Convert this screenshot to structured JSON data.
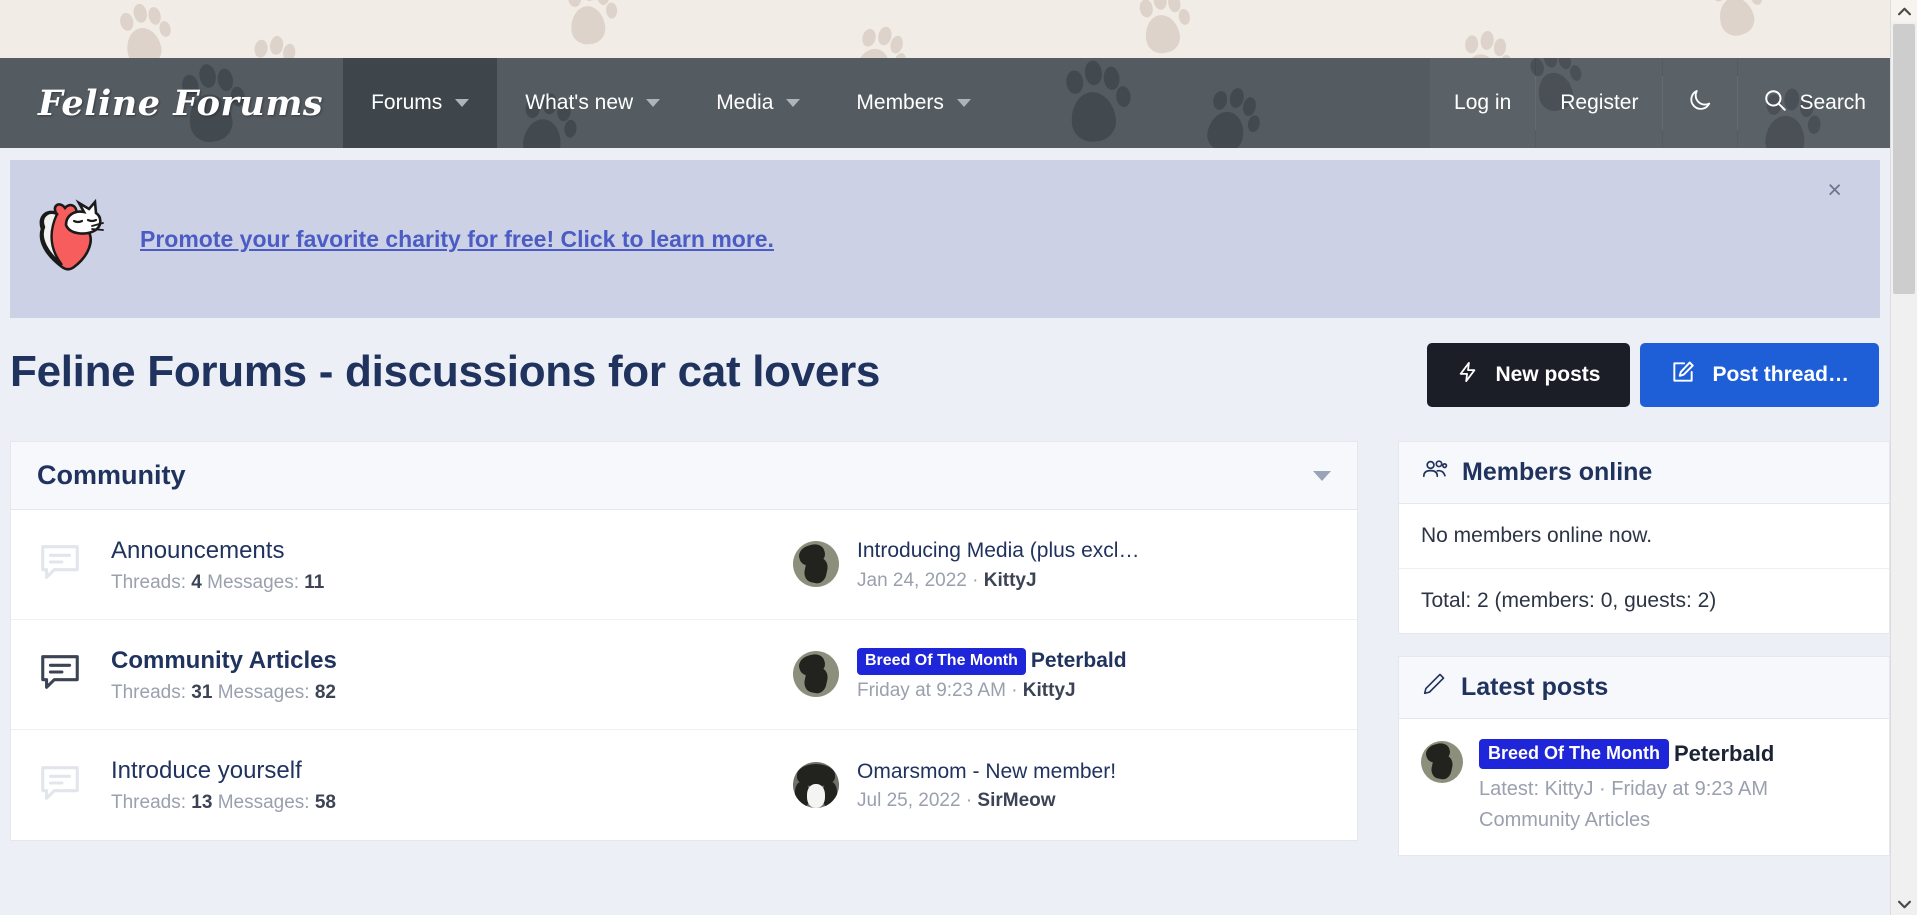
{
  "site": {
    "brand": "Feline Forums"
  },
  "nav": {
    "items": [
      {
        "label": "Forums",
        "has_caret": true,
        "active": true
      },
      {
        "label": "What's new",
        "has_caret": true,
        "active": false
      },
      {
        "label": "Media",
        "has_caret": true,
        "active": false
      },
      {
        "label": "Members",
        "has_caret": true,
        "active": false
      }
    ],
    "right": {
      "login": "Log in",
      "register": "Register",
      "dark_mode_icon": "moon-icon",
      "search": "Search",
      "search_icon": "search-icon"
    }
  },
  "notice": {
    "icon": "cat-heart-icon",
    "link_text": "Promote your favorite charity for free! Click to learn more.",
    "close_label": "×",
    "background": "#ccd1e6",
    "link_color": "#4b5cc4"
  },
  "header": {
    "title": "Feline Forums - discussions for cat lovers",
    "buttons": [
      {
        "label": "New posts",
        "icon": "lightning-icon",
        "style": "dark",
        "color": "#1b1e26"
      },
      {
        "label": "Post thread…",
        "icon": "pencil-square-icon",
        "style": "blue",
        "color": "#1e5fd8"
      }
    ]
  },
  "category": {
    "title": "Community",
    "collapse_icon": "chevron-down-icon",
    "forums": [
      {
        "name": "Announcements",
        "bold": false,
        "icon": "speech-bubble-icon",
        "stats_threads_label": "Threads:",
        "stats_threads_value": "4",
        "stats_messages_label": "Messages:",
        "stats_messages_value": "11",
        "last_post": {
          "avatar": "black-cat-avatar",
          "prefix": "",
          "title": "Introducing Media (plus excl…",
          "date": "Jan 24, 2022",
          "separator": "·",
          "user": "KittyJ"
        }
      },
      {
        "name": "Community Articles",
        "bold": true,
        "icon": "speech-bubble-icon",
        "stats_threads_label": "Threads:",
        "stats_threads_value": "31",
        "stats_messages_label": "Messages:",
        "stats_messages_value": "82",
        "last_post": {
          "avatar": "black-cat-avatar",
          "prefix": "Breed Of The Month",
          "title": "Peterbald",
          "date": "Friday at 9:23 AM",
          "separator": "·",
          "user": "KittyJ"
        }
      },
      {
        "name": "Introduce yourself",
        "bold": false,
        "icon": "speech-bubble-icon",
        "stats_threads_label": "Threads:",
        "stats_threads_value": "13",
        "stats_messages_label": "Messages:",
        "stats_messages_value": "58",
        "last_post": {
          "avatar": "tuxedo-cat-avatar",
          "prefix": "",
          "title": "Omarsmom - New member!",
          "date": "Jul 25, 2022",
          "separator": "·",
          "user": "SirMeow"
        }
      }
    ]
  },
  "sidebar": {
    "members_online": {
      "icon": "people-icon",
      "title": "Members online",
      "empty_text": "No members online now.",
      "total_text": "Total: 2 (members: 0, guests: 2)"
    },
    "latest_posts": {
      "icon": "pencil-icon",
      "title": "Latest posts",
      "items": [
        {
          "avatar": "black-cat-avatar",
          "prefix": "Breed Of The Month",
          "title": "Peterbald",
          "meta": "Latest: KittyJ · Friday at 9:23 AM",
          "forum": "Community Articles"
        }
      ]
    }
  },
  "scrollbar": {
    "up_icon": "chevron-up-icon",
    "down_icon": "chevron-down-icon"
  },
  "colors": {
    "nav_bg": "#545b61",
    "page_bg": "#eceff5",
    "accent_blue": "#1e5fd8",
    "prefix_blue": "#1f25d8",
    "heading": "#20335e",
    "paw_bg": "#f2ece6"
  }
}
